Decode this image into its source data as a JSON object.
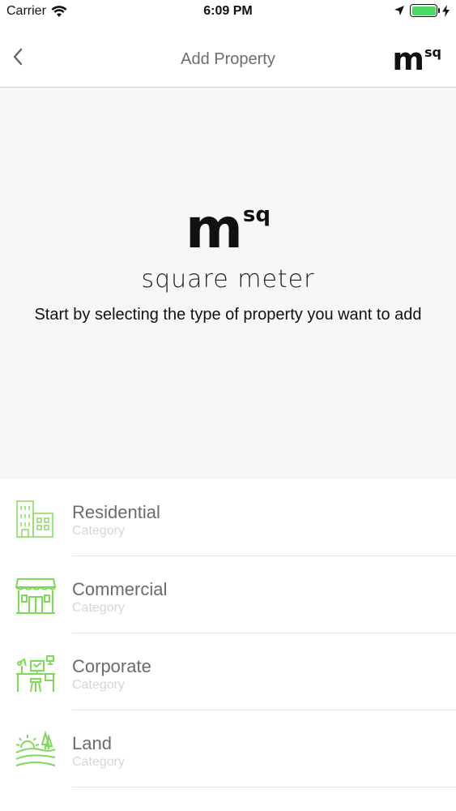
{
  "status": {
    "carrier": "Carrier",
    "time": "6:09 PM"
  },
  "nav": {
    "title": "Add Property",
    "logo_m": "m",
    "logo_sq": "sq"
  },
  "hero": {
    "logo_m": "m",
    "logo_sq": "sq",
    "subtitle": "square meter",
    "instruction": "Start by selecting the type of property you want to add"
  },
  "categories": [
    {
      "title": "Residential",
      "subtitle": "Category",
      "icon": "building-icon"
    },
    {
      "title": "Commercial",
      "subtitle": "Category",
      "icon": "storefront-icon"
    },
    {
      "title": "Corporate",
      "subtitle": "Category",
      "icon": "office-desk-icon"
    },
    {
      "title": "Land",
      "subtitle": "Category",
      "icon": "landscape-icon"
    }
  ],
  "colors": {
    "accent_green": "#7ed957",
    "battery_green": "#4cd964",
    "hero_background": "#f7f6f9"
  }
}
